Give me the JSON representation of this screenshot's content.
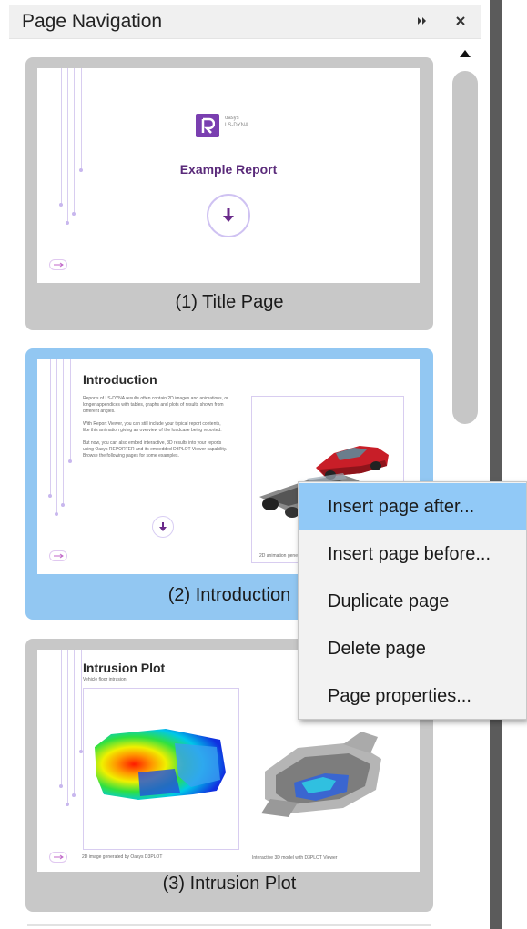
{
  "panel": {
    "title": "Page Navigation",
    "pin_icon": "double-chevron-right-icon",
    "close_icon": "close-icon"
  },
  "pages": [
    {
      "label": "(1) Title Page",
      "thumb_title": "Example Report",
      "logo_text": "oasys\nLS-DYNA",
      "selected": false
    },
    {
      "label": "(2) Introduction",
      "thumb_title": "Introduction",
      "body_text": "Reports of LS-DYNA results often contain 2D images and animations, or longer appendices with tables, graphs and plots of results shown from different angles.\n\nWith Report Viewer, you can still include your typical report contents, like this animation giving an overview of the loadcase being reported.\n\nBut now, you can also embed interactive, 3D results into your reports using Oasys REPORTER and its embedded D3PLOT Viewer capability. Browse the following pages for some examples.",
      "caption": "2D animation generated by Oasys D3PLOT",
      "selected": true
    },
    {
      "label": "(3) Intrusion Plot",
      "thumb_title": "Intrusion Plot",
      "subtitle": "Vehicle floor intrusion",
      "caption_left": "2D image generated by Oasys D3PLOT",
      "caption_right": "Interactive 3D model with D3PLOT Viewer",
      "selected": false
    }
  ],
  "context_menu": {
    "items": [
      "Insert page after...",
      "Insert page before...",
      "Duplicate page",
      "Delete page",
      "Page properties..."
    ],
    "highlighted_index": 0
  },
  "colors": {
    "selected_card": "#92c7f2",
    "card": "#c8c8c8",
    "menu_highlight": "#91c9f7",
    "accent_purple": "#7a3fb0"
  }
}
